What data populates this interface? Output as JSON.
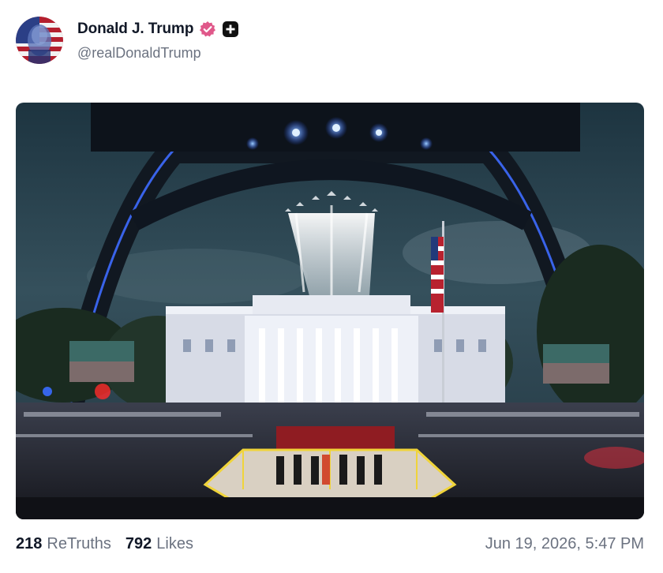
{
  "post": {
    "author": {
      "display_name": "Donald J. Trump",
      "handle": "@realDonaldTrump",
      "verified_icon": "verified-badge-icon",
      "extra_badge_icon": "plus-badge-icon"
    },
    "image": {
      "alt": "Post image"
    },
    "stats": {
      "retruths_count": "218",
      "retruths_label": "ReTruths",
      "likes_count": "792",
      "likes_label": "Likes"
    },
    "timestamp": "Jun 19, 2026, 5:47 PM"
  },
  "colors": {
    "text_primary": "#111827",
    "text_secondary": "#6b7280",
    "verified_pink": "#e0588a",
    "badge_black": "#111111"
  }
}
